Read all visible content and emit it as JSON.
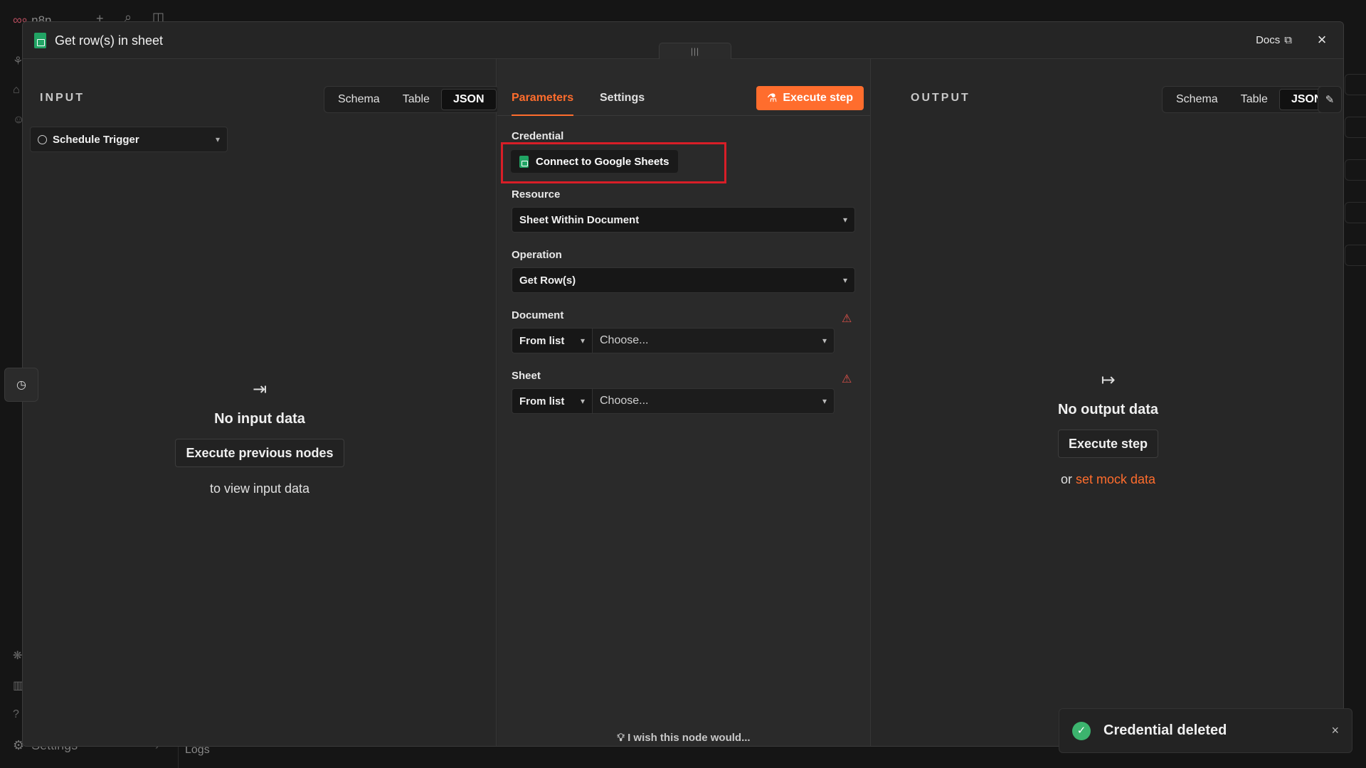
{
  "background": {
    "app_name": "n8n",
    "settings_label": "Settings",
    "logs_label": "Logs"
  },
  "modal": {
    "title": "Get row(s) in sheet",
    "docs_label": "Docs",
    "drag_handle_glyph": "|||"
  },
  "input": {
    "label": "INPUT",
    "views": [
      "Schema",
      "Table",
      "JSON"
    ],
    "active_view": "JSON",
    "trigger": "Schedule Trigger",
    "empty_title": "No input data",
    "execute_prev_label": "Execute previous nodes",
    "hint": "to view input data"
  },
  "params": {
    "tabs": [
      "Parameters",
      "Settings"
    ],
    "active_tab": "Parameters",
    "execute_step_label": "Execute step",
    "credential_label": "Credential",
    "connect_label": "Connect to Google Sheets",
    "resource_label": "Resource",
    "resource_value": "Sheet Within Document",
    "operation_label": "Operation",
    "operation_value": "Get Row(s)",
    "document_label": "Document",
    "document_mode": "From list",
    "document_placeholder": "Choose...",
    "sheet_label": "Sheet",
    "sheet_mode": "From list",
    "sheet_placeholder": "Choose...",
    "wish_text": "I wish this node would..."
  },
  "output": {
    "label": "OUTPUT",
    "views": [
      "Schema",
      "Table",
      "JSON"
    ],
    "active_view": "JSON",
    "empty_title": "No output data",
    "execute_label": "Execute step",
    "or_text": "or",
    "mock_link": "set mock data"
  },
  "toast": {
    "message": "Credential deleted"
  },
  "colors": {
    "accent": "#ff6d2d",
    "highlight": "#d81e27",
    "success": "#3cb46e",
    "sheets_green": "#21a464"
  }
}
